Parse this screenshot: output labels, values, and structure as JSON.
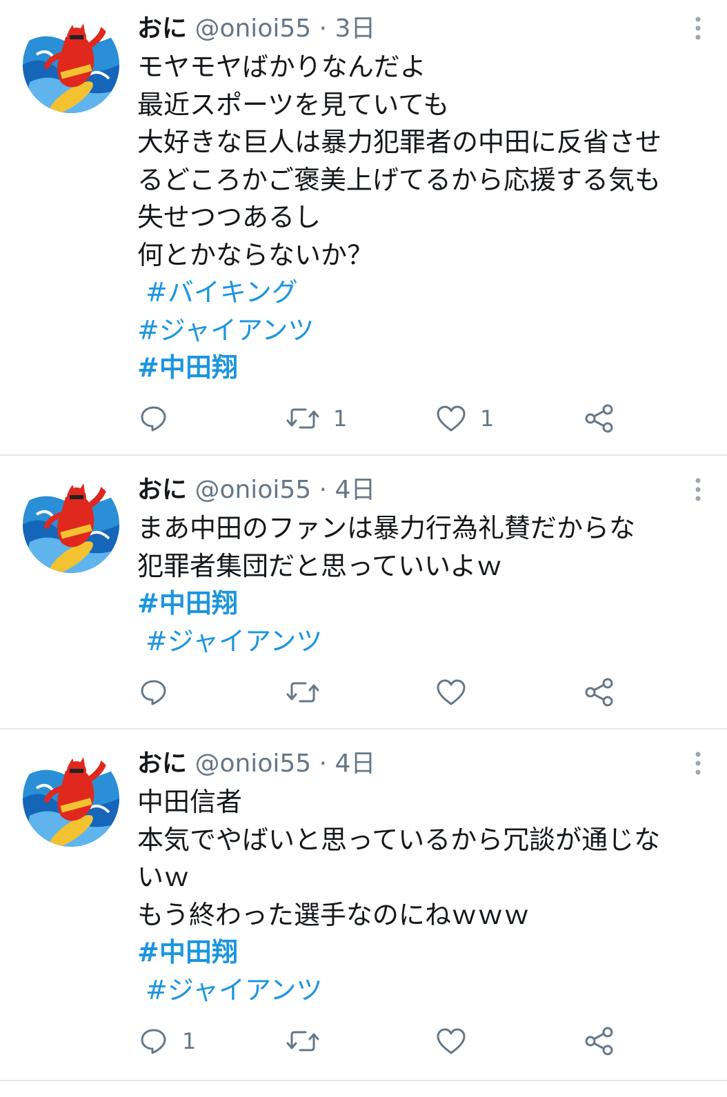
{
  "colors": {
    "hashtag": "#1b95e0",
    "text": "#14171a",
    "secondary": "#657786",
    "divider": "#e1e8ed"
  },
  "tweets": [
    {
      "user": {
        "name": "おに",
        "handle": "@onioi55",
        "separator": "·",
        "time": "3日"
      },
      "text_lines": [
        "モヤモヤばかりなんだよ",
        "最近スポーツを見ていても",
        "大好きな巨人は暴力犯罪者の中田に反省させ",
        "るどころかご褒美上げてるから応援する気も",
        "失せつつあるし",
        "何とかならないか？"
      ],
      "hashtags": [
        "#バイキング",
        "#ジャイアンツ",
        "#中田翔"
      ],
      "actions": {
        "reply": "",
        "retweet": "1",
        "like": "1"
      },
      "icons": [
        "reply-icon",
        "retweet-icon",
        "like-icon",
        "share-icon",
        "more-icon"
      ]
    },
    {
      "user": {
        "name": "おに",
        "handle": "@onioi55",
        "separator": "·",
        "time": "4日"
      },
      "text_lines": [
        "まあ中田のファンは暴力行為礼賛だからな",
        "犯罪者集団だと思っていいよｗ"
      ],
      "hashtags": [
        "#中田翔",
        "#ジャイアンツ"
      ],
      "actions": {
        "reply": "",
        "retweet": "",
        "like": ""
      },
      "icons": [
        "reply-icon",
        "retweet-icon",
        "like-icon",
        "share-icon",
        "more-icon"
      ]
    },
    {
      "user": {
        "name": "おに",
        "handle": "@onioi55",
        "separator": "·",
        "time": "4日"
      },
      "text_lines": [
        "中田信者",
        "本気でやばいと思っているから冗談が通じな",
        "いｗ",
        "もう終わった選手なのにねｗｗｗ"
      ],
      "hashtags": [
        "#中田翔",
        "#ジャイアンツ"
      ],
      "actions": {
        "reply": "1",
        "retweet": "",
        "like": ""
      },
      "icons": [
        "reply-icon",
        "retweet-icon",
        "like-icon",
        "share-icon",
        "more-icon"
      ]
    }
  ]
}
